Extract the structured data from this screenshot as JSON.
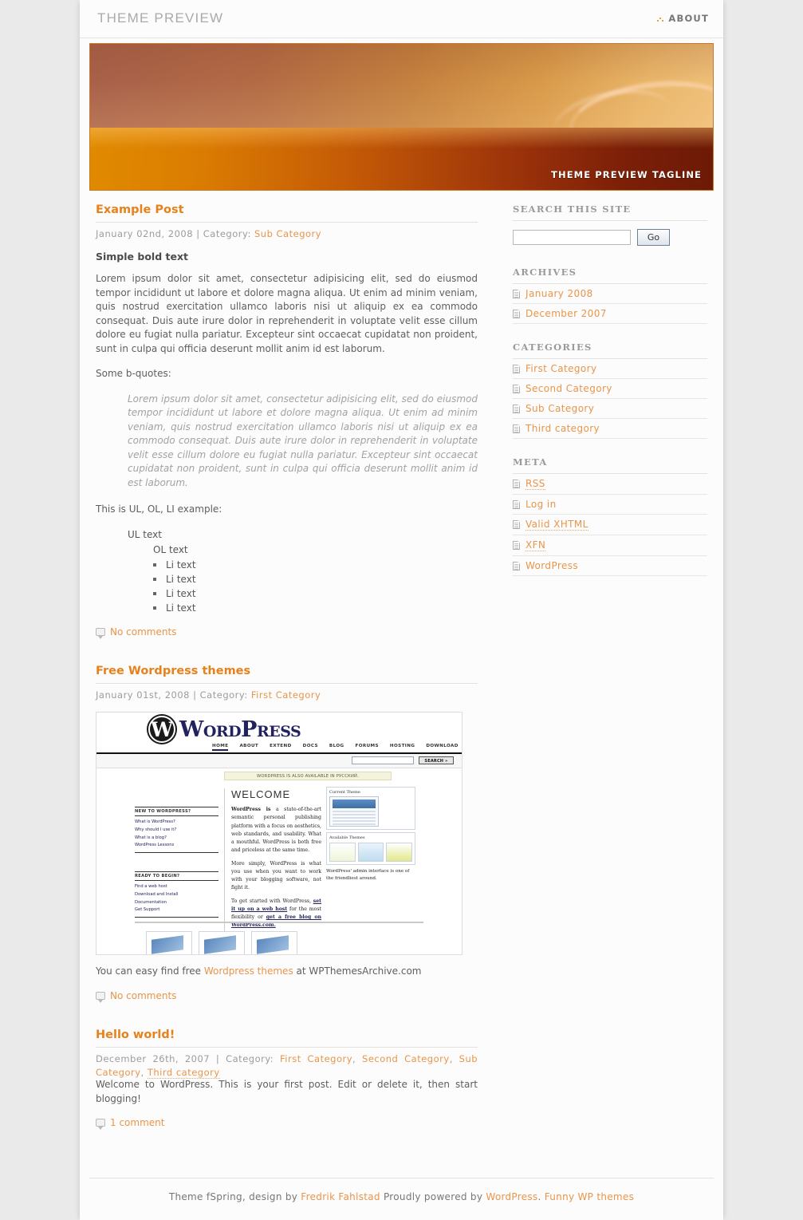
{
  "site": {
    "title": "THEME PREVIEW",
    "tagline": "THEME PREVIEW TAGLINE",
    "nav": [
      {
        "label": "ABOUT"
      }
    ]
  },
  "posts": [
    {
      "title": "Example Post",
      "date": "January 02nd, 2008",
      "meta_separator": "|",
      "category_label": "Category:",
      "categories": [
        "Sub Category"
      ],
      "subheading": "Simple bold text",
      "paragraph1": "Lorem ipsum dolor sit amet, consectetur adipisicing elit, sed do eiusmod tempor incididunt ut labore et dolore magna aliqua. Ut enim ad minim veniam, quis nostrud exercitation ullamco laboris nisi ut aliquip ex ea commodo consequat. Duis aute irure dolor in reprehenderit in voluptate velit esse cillum dolore eu fugiat nulla pariatur. Excepteur sint occaecat cupidatat non proident, sunt in culpa qui officia deserunt mollit anim id est laborum.",
      "quote_intro": "Some b-quotes:",
      "blockquote": "Lorem ipsum dolor sit amet, consectetur adipisicing elit, sed do eiusmod tempor incididunt ut labore et dolore magna aliqua. Ut enim ad minim veniam, quis nostrud exercitation ullamco laboris nisi ut aliquip ex ea commodo consequat. Duis aute irure dolor in reprehenderit in voluptate velit esse cillum dolore eu fugiat nulla pariatur. Excepteur sint occaecat cupidatat non proident, sunt in culpa qui officia deserunt mollit anim id est laborum.",
      "list_intro": "This is UL, OL, LI example:",
      "ul_text": "UL text",
      "ol_text": "OL text",
      "li_items": [
        "Li text",
        "Li text",
        "Li text",
        "Li text"
      ],
      "comments": "No comments"
    },
    {
      "title": "Free Wordpress themes",
      "date": "January 01st, 2008",
      "meta_separator": "|",
      "category_label": "Category:",
      "categories": [
        "First Category"
      ],
      "body_prefix": "You can easy find free ",
      "body_link": "Wordpress themes",
      "body_suffix": " at WPThemesArchive.com",
      "comments": "No comments"
    },
    {
      "title": "Hello world!",
      "date": "December 26th, 2007",
      "meta_separator": "|",
      "category_label": "Category:",
      "categories": [
        "First Category",
        "Second Category",
        "Sub Category",
        "Third category"
      ],
      "body": "Welcome to WordPress. This is your first post. Edit or delete it, then start blogging!",
      "comments": "1 comment"
    }
  ],
  "wp_screenshot": {
    "logo_letter": "W",
    "logo_word": "WordPress",
    "nav": [
      "HOME",
      "ABOUT",
      "EXTEND",
      "DOCS",
      "BLOG",
      "FORUMS",
      "HOSTING",
      "DOWNLOAD"
    ],
    "search_button": "SEARCH »",
    "notice": "WORDPRESS IS ALSO AVAILABLE IN РУССКИЙ.",
    "left_col_heading": "NEW TO WORDPRESS?",
    "left_col_links": [
      "What is WordPress?",
      "Why should I use it?",
      "What is a blog?",
      "WordPress Lessons"
    ],
    "left_col2_heading": "READY TO BEGIN?",
    "left_col2_links": [
      "Find a web host",
      "Download and Install",
      "Documentation",
      "Get Support"
    ],
    "welcome_heading": "WELCOME",
    "welcome_p1_bold": "WordPress is",
    "welcome_p1": " a state-of-the-art semantic personal publishing platform with a focus on aesthetics, web standards, and usability. What a mouthful. WordPress is both free and priceless at the same time.",
    "welcome_p2": "More simply, WordPress is what you use when you want to work with your blogging software, not fight it.",
    "welcome_p3_pre": "To get started with WordPress, ",
    "welcome_p3_link1": "set it up on a web host",
    "welcome_p3_mid": " for the most flexibility or ",
    "welcome_p3_link2": "get a free blog on WordPress.com.",
    "panel1_label": "Current Theme",
    "panel2_label": "Available Themes",
    "panel_caption": "WordPress' admin interface is one of the friendliest around."
  },
  "sidebar": {
    "search": {
      "heading": "SEARCH THIS SITE",
      "value": "",
      "placeholder": "",
      "button": "Go"
    },
    "archives": {
      "heading": "ARCHIVES",
      "items": [
        "January 2008",
        "December 2007"
      ]
    },
    "categories": {
      "heading": "CATEGORIES",
      "items": [
        "First Category",
        "Second Category",
        "Sub Category",
        "Third category"
      ]
    },
    "meta": {
      "heading": "META",
      "items": [
        {
          "label": "RSS",
          "dotted": true
        },
        {
          "label": "Log in",
          "dotted": false
        },
        {
          "label": "Valid XHTML",
          "dotted": true
        },
        {
          "label": "XFN",
          "dotted": true
        },
        {
          "label": "WordPress",
          "dotted": false
        }
      ]
    }
  },
  "footer": {
    "text1": "Theme fSpring, design by ",
    "link1": "Fredrik Fahlstad",
    "text2": " Proudly powered by ",
    "link2": "WordPress",
    "text3": ". ",
    "link3": "Funny WP themes"
  },
  "colors": {
    "accent": "#e8811a",
    "link": "#e8954a",
    "page_bg": "#eaeaea",
    "content_bg": "#fcfcfc",
    "banner_top": "#c4813f",
    "banner_bottom": "#9c330a"
  }
}
